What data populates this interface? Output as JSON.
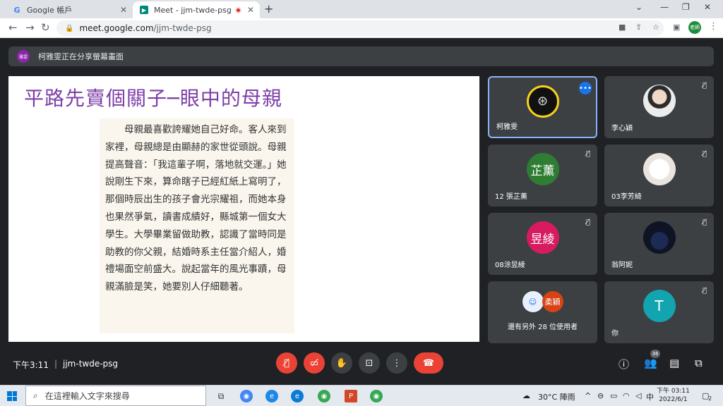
{
  "browser": {
    "tabs": [
      {
        "title": "Google 帳戶",
        "favicon": "google-g-icon"
      },
      {
        "title": "Meet - jjm-twde-psg",
        "favicon": "meet-icon"
      }
    ],
    "url_domain": "meet.google.com",
    "url_path": "/jjm-twde-psg",
    "profile_label": "老師"
  },
  "meet": {
    "banner_avatar": "雅雯",
    "banner_text": "柯雅雯正在分享螢幕畫面",
    "slide": {
      "title": "平路先賣個關子─眼中的母親",
      "paragraph": "母親最喜歡誇耀她自己好命。客人來到家裡，母親總是由顯赫的家世從頭說。母親提高聲音：「我這輩子啊，落地就交運。」她說剛生下來，算命瞎子已經紅紙上寫明了，那個時辰出生的孩子會光宗耀祖，而她本身也果然爭氣，讀書成績好，縣城第一個女大學生。大學畢業留做助教，認識了當時同是助教的你父親，結婚時系主任當介紹人，婚禮場面空前盛大。說起當年的風光事蹟，母親滿臉是笑，她要別人仔細聽著。"
    },
    "participants": [
      {
        "name": "柯雅雯",
        "avatar_type": "grid",
        "active": true
      },
      {
        "name": "李心穎",
        "avatar_type": "photo1",
        "muted": true
      },
      {
        "name": "12 張芷薰",
        "avatar_text": "芷薰",
        "color": "#2e7d32",
        "muted": true
      },
      {
        "name": "03李芳綺",
        "avatar_type": "photo2",
        "muted": true
      },
      {
        "name": "08涂昱綾",
        "avatar_text": "昱綾",
        "color": "#d81b60",
        "muted": true
      },
      {
        "name": "翁阿妮",
        "avatar_type": "photo3",
        "muted": true
      },
      {
        "name": "還有另外 28 位使用者",
        "others": true,
        "avatar_text": "柔穎"
      },
      {
        "name": "你",
        "avatar_text": "T",
        "color": "#12a4af",
        "muted": true
      }
    ],
    "bottom": {
      "time": "下午3:11",
      "meeting_code": "jjm-twde-psg",
      "people_count": "36"
    }
  },
  "taskbar": {
    "search_placeholder": "在這裡輸入文字來搜尋",
    "weather": "30°C 陣雨",
    "ime": "中",
    "clock_time": "下午 03:11",
    "clock_date": "2022/6/1",
    "notifications": "2"
  }
}
